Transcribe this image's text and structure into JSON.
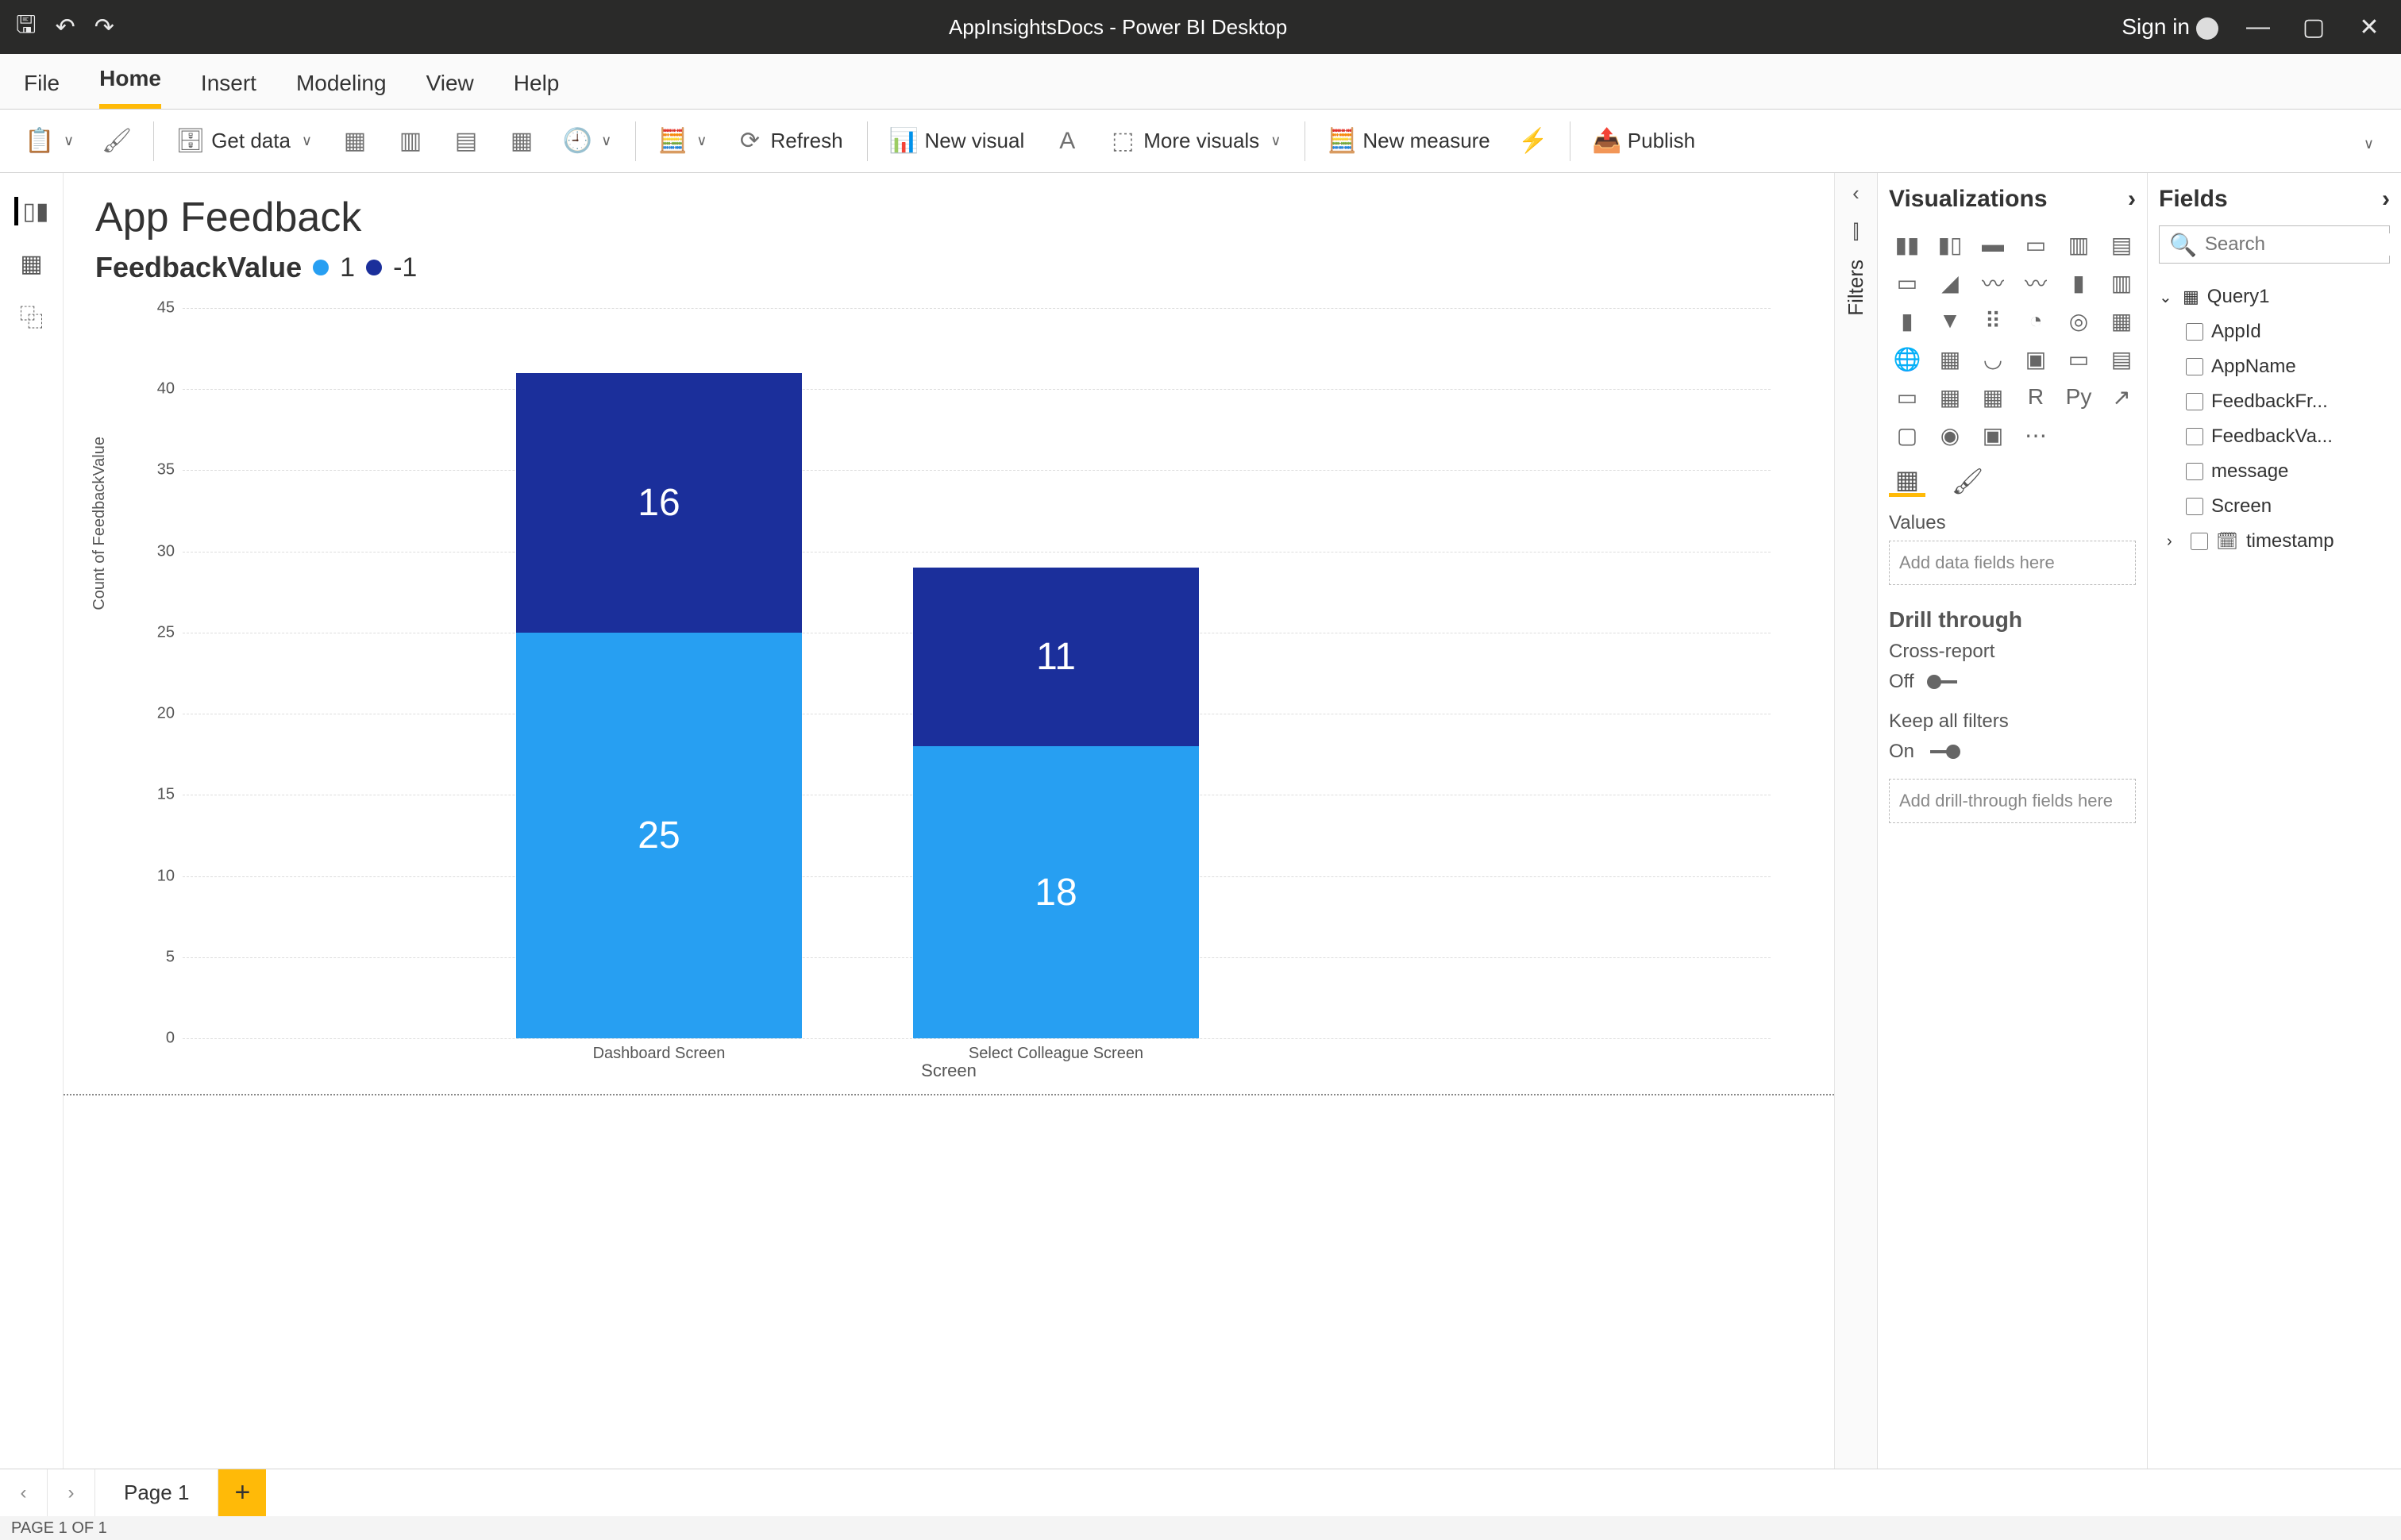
{
  "window": {
    "title": "AppInsightsDocs - Power BI Desktop",
    "signin": "Sign in"
  },
  "menu": {
    "items": [
      "File",
      "Home",
      "Insert",
      "Modeling",
      "View",
      "Help"
    ],
    "active": "Home"
  },
  "ribbon": {
    "get_data": "Get data",
    "refresh": "Refresh",
    "new_visual": "New visual",
    "more_visuals": "More visuals",
    "new_measure": "New measure",
    "publish": "Publish"
  },
  "report": {
    "title": "App Feedback",
    "legend_label": "FeedbackValue",
    "series": [
      {
        "name": "1",
        "color": "#279ff2"
      },
      {
        "name": "-1",
        "color": "#1b2f9b"
      }
    ]
  },
  "chart_data": {
    "type": "bar",
    "stacked": true,
    "xlabel": "Screen",
    "ylabel": "Count of FeedbackValue",
    "ylim": [
      0,
      45
    ],
    "yticks": [
      0,
      5,
      10,
      15,
      20,
      25,
      30,
      35,
      40,
      45
    ],
    "categories": [
      "Dashboard Screen",
      "Select Colleague Screen"
    ],
    "series": [
      {
        "name": "1",
        "color": "#279ff2",
        "values": [
          25,
          18
        ]
      },
      {
        "name": "-1",
        "color": "#1b2f9b",
        "values": [
          16,
          11
        ]
      }
    ]
  },
  "filters_label": "Filters",
  "viz_pane": {
    "title": "Visualizations",
    "values_label": "Values",
    "values_placeholder": "Add data fields here",
    "drill_title": "Drill through",
    "cross_report_label": "Cross-report",
    "cross_report_value": "Off",
    "keep_filters_label": "Keep all filters",
    "keep_filters_value": "On",
    "drill_placeholder": "Add drill-through fields here"
  },
  "fields_pane": {
    "title": "Fields",
    "search_placeholder": "Search",
    "table": "Query1",
    "columns": [
      "AppId",
      "AppName",
      "FeedbackFr...",
      "FeedbackVa...",
      "message",
      "Screen"
    ],
    "time_col": "timestamp"
  },
  "page_tabs": {
    "current": "Page 1"
  },
  "status": "PAGE 1 OF 1"
}
